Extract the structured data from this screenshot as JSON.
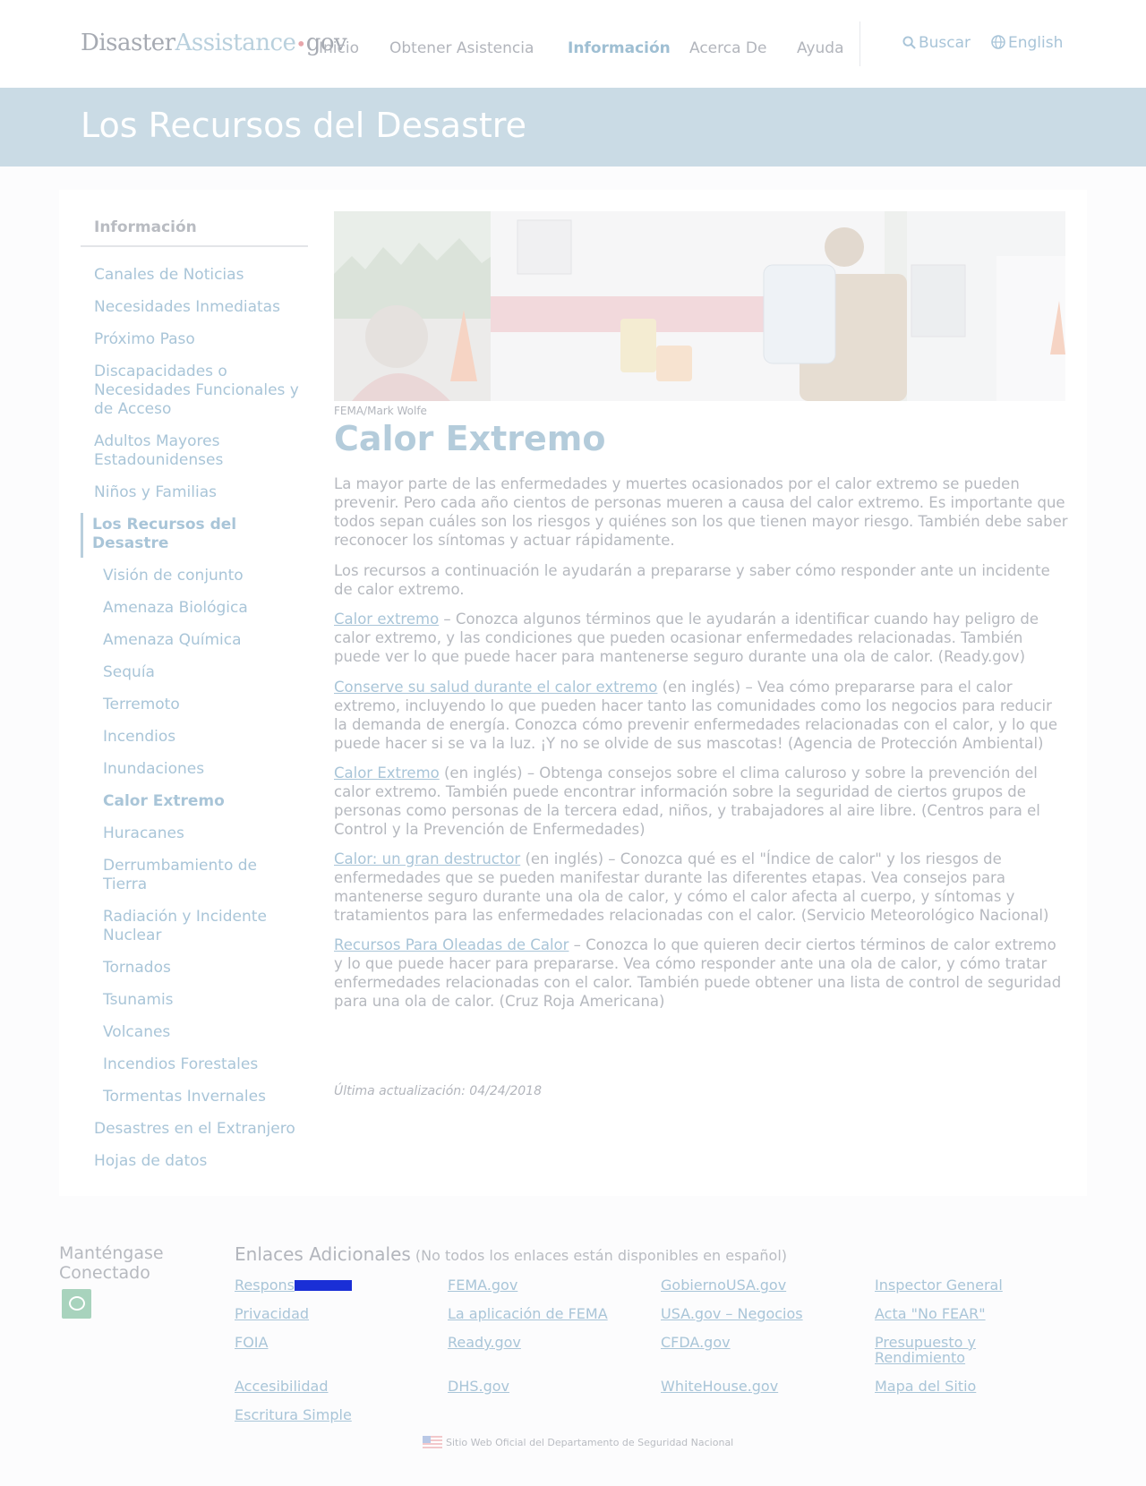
{
  "header": {
    "logo": {
      "part1": "Disaster",
      "part2": "Assistance",
      "dot": "•",
      "part3": "gov"
    },
    "nav": [
      {
        "label": "Inicio"
      },
      {
        "label": "Obtener Asistencia"
      },
      {
        "label": "Información",
        "active": true
      },
      {
        "label": "Acerca De"
      },
      {
        "label": "Ayuda"
      }
    ],
    "search_label": "Buscar",
    "language_label": "English"
  },
  "banner": {
    "title": "Los Recursos del Desastre"
  },
  "sidebar": {
    "heading": "Información",
    "items": [
      {
        "label": "Canales de Noticias"
      },
      {
        "label": "Necesidades Inmediatas"
      },
      {
        "label": "Próximo Paso"
      },
      {
        "label": "Discapacidades o Necesidades Funcionales y de Acceso"
      },
      {
        "label": "Adultos Mayores Estadounidenses"
      },
      {
        "label": "Niños y Familias"
      },
      {
        "label": "Los Recursos del Desastre",
        "active": true
      }
    ],
    "subitems": [
      {
        "label": "Visión de conjunto"
      },
      {
        "label": "Amenaza Biológica"
      },
      {
        "label": "Amenaza Química"
      },
      {
        "label": "Sequía"
      },
      {
        "label": "Terremoto"
      },
      {
        "label": "Incendios"
      },
      {
        "label": "Inundaciones"
      },
      {
        "label": "Calor Extremo",
        "current": true
      },
      {
        "label": "Huracanes"
      },
      {
        "label": "Derrumbamiento de Tierra"
      },
      {
        "label": "Radiación y Incidente Nuclear"
      },
      {
        "label": "Tornados"
      },
      {
        "label": "Tsunamis"
      },
      {
        "label": "Volcanes"
      },
      {
        "label": "Incendios Forestales"
      },
      {
        "label": "Tormentas Invernales"
      }
    ],
    "after_items": [
      {
        "label": "Desastres en el Extranjero"
      },
      {
        "label": "Hojas de datos"
      }
    ]
  },
  "article": {
    "image_caption": "FEMA/Mark Wolfe",
    "title": "Calor Extremo",
    "intro": "La mayor parte de las enfermedades y muertes ocasionados por el calor extremo se pueden prevenir. Pero cada año cientos de personas mueren a causa del calor extremo. Es importante que todos sepan cuáles son los riesgos y quiénes son los que tienen mayor riesgo. También debe saber reconocer los síntomas y actuar rápidamente.",
    "intro2": "Los recursos a continuación le ayudarán a prepararse y saber cómo responder ante un incidente de calor extremo.",
    "resources": [
      {
        "link": "Calor extremo",
        "text": " – Conozca algunos términos que le ayudarán a identificar cuando hay peligro de calor extremo, y las condiciones que pueden ocasionar enfermedades relacionadas. También puede ver lo que puede hacer para mantenerse seguro durante una ola de calor. (Ready.gov)"
      },
      {
        "link": "Conserve su salud durante el calor extremo",
        "text": " (en inglés) – Vea cómo prepararse para el calor extremo, incluyendo lo que pueden hacer tanto las comunidades como los negocios para reducir la demanda de energía. Conozca cómo prevenir enfermedades relacionadas con el calor, y lo que puede hacer si se va la luz. ¡Y no se olvide de sus mascotas! (Agencia de Protección Ambiental)"
      },
      {
        "link": "Calor Extremo",
        "text": " (en inglés) – Obtenga consejos sobre el clima caluroso y sobre la prevención del calor extremo. También puede encontrar información sobre la seguridad de ciertos grupos de personas como personas de la tercera edad, niños, y trabajadores al aire libre. (Centros para el Control y la Prevención de Enfermedades)"
      },
      {
        "link": "Calor: un gran destructor",
        "text": " (en inglés) – Conozca qué es el \"Índice de calor\" y los riesgos de enfermedades que se pueden manifestar durante las diferentes etapas. Vea consejos para mantenerse seguro durante una ola de calor, y cómo el calor afecta al cuerpo, y síntomas y tratamientos para las enfermedades relacionadas con el calor. (Servicio Meteorológico Nacional)"
      },
      {
        "link": "Recursos Para Oleadas de Calor",
        "text": " – Conozca lo que quieren decir ciertos términos de calor extremo y lo que puede hacer para prepararse. Vea cómo responder ante una ola de calor, y cómo tratar enfermedades relacionadas con el calor. También puede obtener una lista de control de seguridad para una ola de calor. (Cruz Roja Americana)"
      }
    ],
    "last_updated": "Última actualización: 04/24/2018"
  },
  "footer": {
    "connect_heading": "Manténgase Conectado",
    "links_heading": "Enlaces Adicionales",
    "links_note": " (No todos los enlaces están disponibles en español)",
    "links": [
      {
        "label": "Respons"
      },
      {
        "label": "FEMA.gov"
      },
      {
        "label": "GobiernoUSA.gov"
      },
      {
        "label": "Inspector General"
      },
      {
        "label": "Privacidad"
      },
      {
        "label": "La aplicación de FEMA"
      },
      {
        "label": "USA.gov – Negocios"
      },
      {
        "label": "Acta \"No FEAR\""
      },
      {
        "label": "FOIA"
      },
      {
        "label": "Ready.gov"
      },
      {
        "label": "CFDA.gov"
      },
      {
        "label": "Presupuesto y Rendimiento"
      },
      {
        "label": "Accesibilidad"
      },
      {
        "label": "DHS.gov"
      },
      {
        "label": "WhiteHouse.gov"
      },
      {
        "label": "Mapa del Sitio"
      },
      {
        "label": "Escritura Simple"
      }
    ],
    "official_text": "Sitio Web Oficial del Departamento de Seguridad Nacional"
  }
}
